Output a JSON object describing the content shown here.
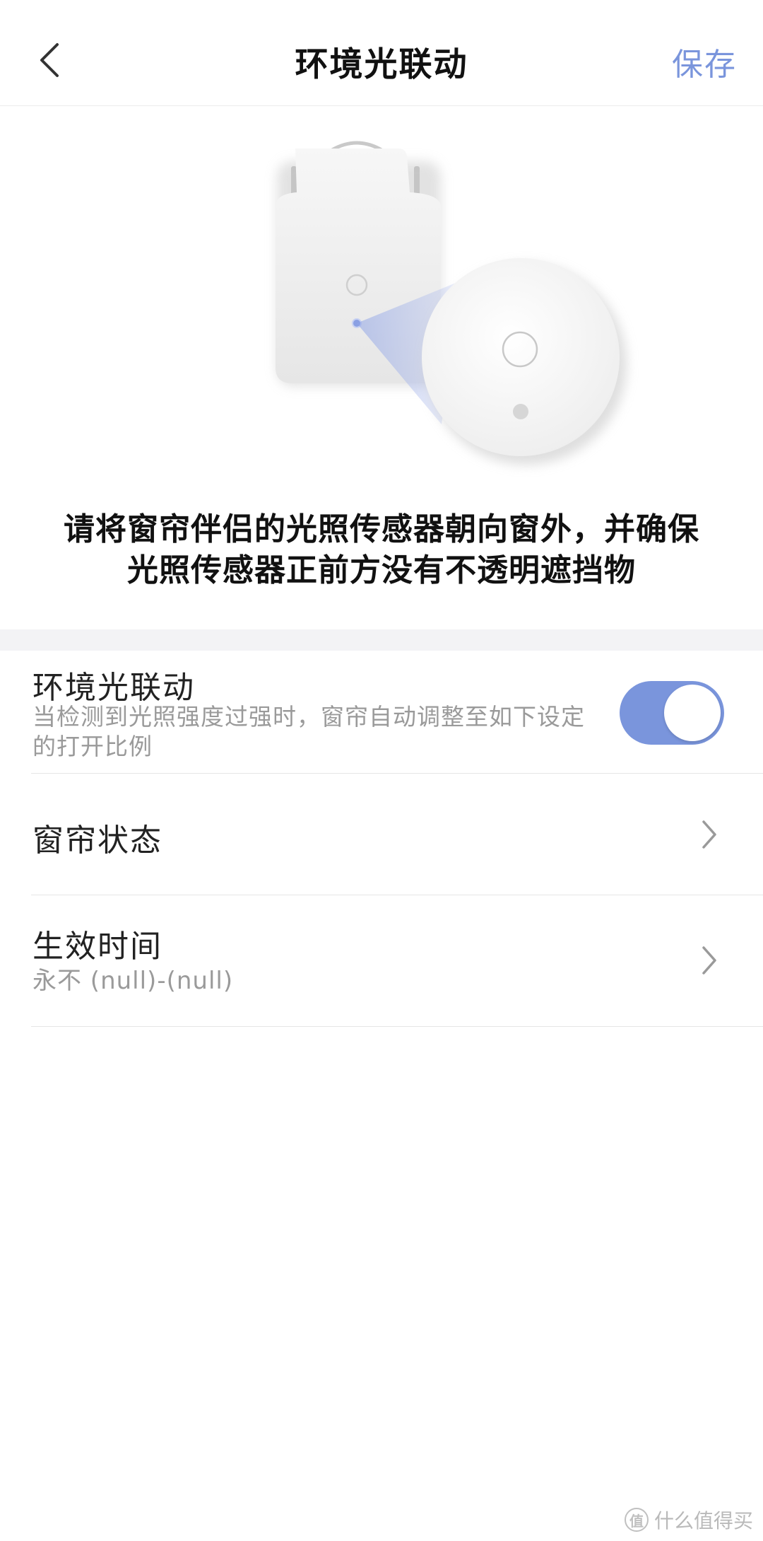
{
  "header": {
    "title": "环境光联动",
    "save_label": "保存"
  },
  "instruction": {
    "line1": "请将窗帘伴侣的光照传感器朝向窗外，并确保",
    "line2": "光照传感器正前方没有不透明遮挡物"
  },
  "settings": {
    "ambient": {
      "title": "环境光联动",
      "desc": "当检测到光照强度过强时，窗帘自动调整至如下设定的打开比例",
      "enabled": true
    },
    "curtain_state": {
      "title": "窗帘状态"
    },
    "effective_time": {
      "title": "生效时间",
      "value": "永不 (null)-(null)"
    }
  },
  "colors": {
    "accent": "#7a95dc"
  },
  "watermark": {
    "text": "什么值得买",
    "logo_char": "值"
  }
}
